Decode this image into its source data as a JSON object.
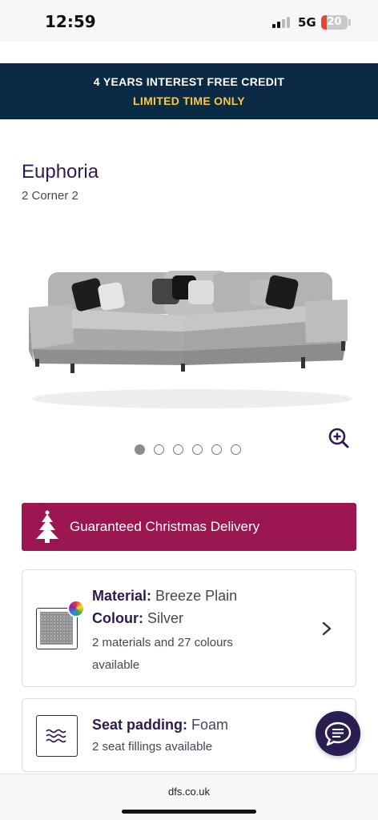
{
  "status_bar": {
    "time": "12:59",
    "network": "5G",
    "battery": "20",
    "battery_level": 0.2
  },
  "promo": {
    "line1": "4 YEARS INTEREST FREE CREDIT",
    "line2": "LIMITED TIME ONLY"
  },
  "product": {
    "title": "Euphoria",
    "subtitle": "2 Corner 2"
  },
  "gallery": {
    "image_count": 6,
    "active_index": 0
  },
  "delivery": {
    "label": "Guaranteed Christmas Delivery",
    "color": "#9c1651"
  },
  "material_card": {
    "material_label": "Material:",
    "material_value": "Breeze Plain",
    "colour_label": "Colour:",
    "colour_value": "Silver",
    "availability": "2 materials and 27 colours available"
  },
  "seat_card": {
    "label": "Seat padding:",
    "value": "Foam",
    "availability": "2 seat fillings available"
  },
  "browser": {
    "url": "dfs.co.uk"
  },
  "colors": {
    "banner_bg": "#0a2a45",
    "banner_highlight": "#f6c945",
    "brand_purple": "#2e1a4f"
  },
  "icons": [
    "zoom-in-icon",
    "christmas-tree-icon",
    "color-wheel-icon",
    "chevron-right-icon",
    "wave-padding-icon",
    "chat-icon"
  ]
}
